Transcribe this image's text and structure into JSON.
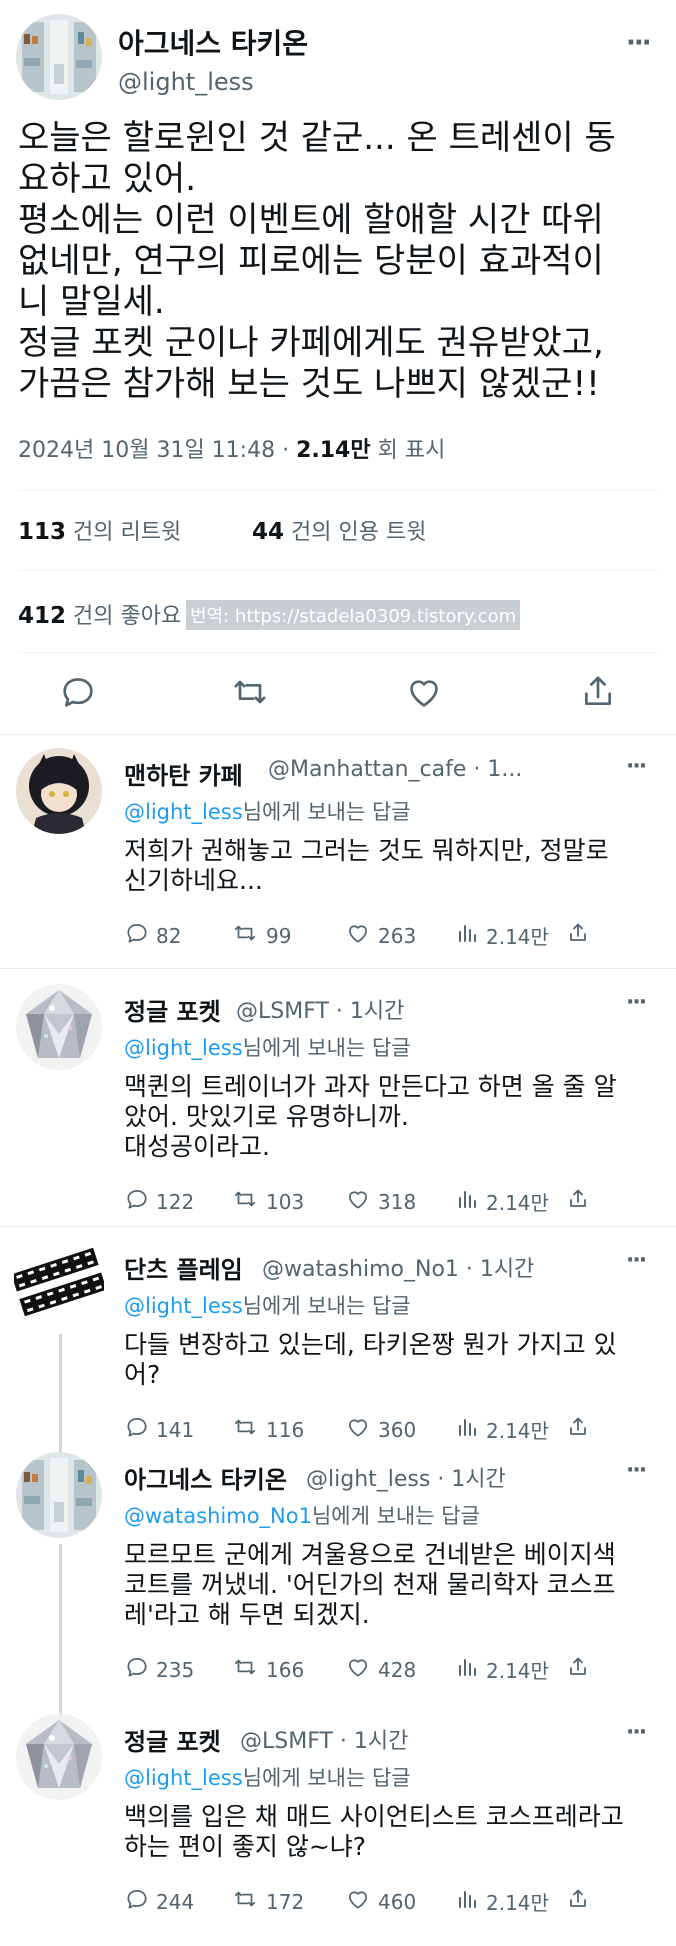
{
  "main_tweet": {
    "display_name": "아그네스 타키온",
    "handle": "@light_less",
    "more": "···",
    "text_lines": [
      "오늘은 할로윈인 것 같군... 온 트레센이 동",
      "요하고 있어.",
      "평소에는 이런 이벤트에 할애할 시간 따위",
      "없네만, 연구의 피로에는 당분이 효과적이",
      "니 말일세.",
      "정글 포켓 군이나 카페에게도 권유받았고,",
      "가끔은 참가해 보는 것도 나쁘지 않겠군!!"
    ],
    "timestamp": "2024년 10월 31일  11:48",
    "dot": "·",
    "views": "2.14만",
    "views_label": "회 표시",
    "retweets": "113",
    "retweets_label": "건의 리트윗",
    "quotes": "44",
    "quotes_label": "건의 인용 트윗",
    "likes": "412",
    "likes_label": "건의 좋아요",
    "translation_note": "번역: https://stadela0309.tistory.com"
  },
  "replies": [
    {
      "name": "맨하탄 카페",
      "handle": "@Manhattan_cafe · 1...",
      "to_handle": "@light_less",
      "to_suffix": "님에게 보내는 답글",
      "text_lines": [
        "저희가 권해놓고 그러는 것도 뭐하지만, 정말로",
        "신기하네요..."
      ],
      "replies": "82",
      "retweets": "99",
      "likes": "263",
      "views": "2.14만"
    },
    {
      "name": "정글 포켓",
      "handle": "@LSMFT · 1시간",
      "to_handle": "@light_less",
      "to_suffix": "님에게 보내는 답글",
      "text_lines": [
        "맥퀸의 트레이너가 과자 만든다고 하면 올 줄 알",
        "았어. 맛있기로 유명하니까.",
        "대성공이라고."
      ],
      "replies": "122",
      "retweets": "103",
      "likes": "318",
      "views": "2.14만"
    },
    {
      "name": "단츠 플레임",
      "handle": "@watashimo_No1 · 1시간",
      "to_handle": "@light_less",
      "to_suffix": "님에게 보내는 답글",
      "text_lines": [
        "다들 변장하고 있는데, 타키온짱 뭔가 가지고 있",
        "어?"
      ],
      "replies": "141",
      "retweets": "116",
      "likes": "360",
      "views": "2.14만"
    },
    {
      "name": "아그네스 타키온",
      "handle": "@light_less · 1시간",
      "to_handle": "@watashimo_No1",
      "to_suffix": "님에게 보내는 답글",
      "text_lines": [
        "모르모트 군에게 겨울용으로 건네받은 베이지색",
        "코트를 꺼냈네. '어딘가의 천재 물리학자 코스프",
        "레'라고 해 두면 되겠지."
      ],
      "replies": "235",
      "retweets": "166",
      "likes": "428",
      "views": "2.14만"
    },
    {
      "name": "정글 포켓",
      "handle": "@LSMFT · 1시간",
      "to_handle": "@light_less",
      "to_suffix": "님에게 보내는 답글",
      "text_lines": [
        "백의를 입은 채 매드 사이언티스트 코스프레라고",
        "하는 편이 좋지 않~냐?"
      ],
      "replies": "244",
      "retweets": "172",
      "likes": "460",
      "views": "2.14만"
    }
  ],
  "colors": {
    "text": "#0f1419",
    "secondary": "#536471",
    "link": "#1d9bf0",
    "divider": "#eff3f4"
  },
  "icons": [
    "reply-icon",
    "retweet-icon",
    "like-icon",
    "views-icon",
    "share-icon",
    "more-icon"
  ]
}
